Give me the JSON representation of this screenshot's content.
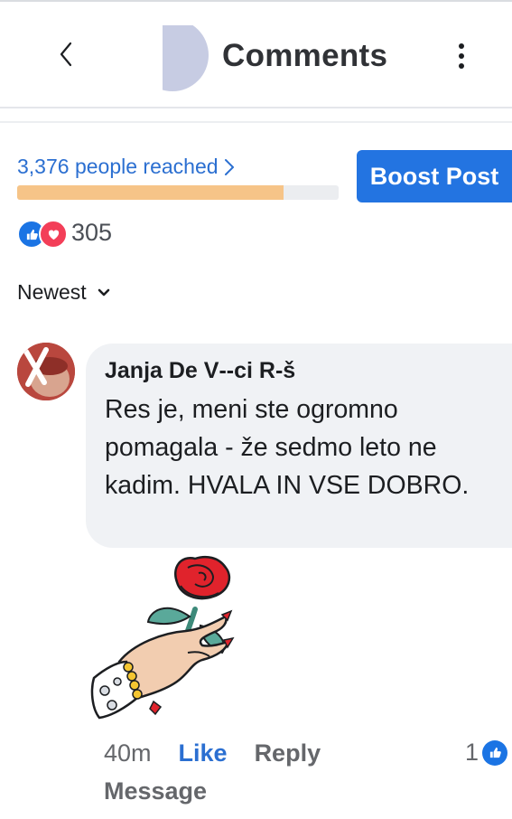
{
  "header": {
    "title": "Comments",
    "back_icon": "chevron-left-icon",
    "more_icon": "vertical-dots-icon"
  },
  "stats": {
    "reach_label": "3,376 people reached",
    "reach_progress_percent": 83,
    "boost_label": "Boost Post",
    "reaction_count": "305"
  },
  "sort": {
    "label": "Newest"
  },
  "comment": {
    "author": "Janja De V‑‑ci R‑š",
    "text": "Res je, meni ste ogromno pomagala - že sedmo leto ne kadim. HVALA IN VSE DOBRO.",
    "time": "40m",
    "like_label": "Like",
    "reply_label": "Reply",
    "message_label": "Message",
    "like_count": "1",
    "sticker": "hand-holding-rose-sticker"
  },
  "colors": {
    "accent": "#2374e1",
    "link": "#2b6fd1",
    "progress_fill": "#f6c488",
    "bubble": "#f0f2f5",
    "love": "#f33e58"
  }
}
